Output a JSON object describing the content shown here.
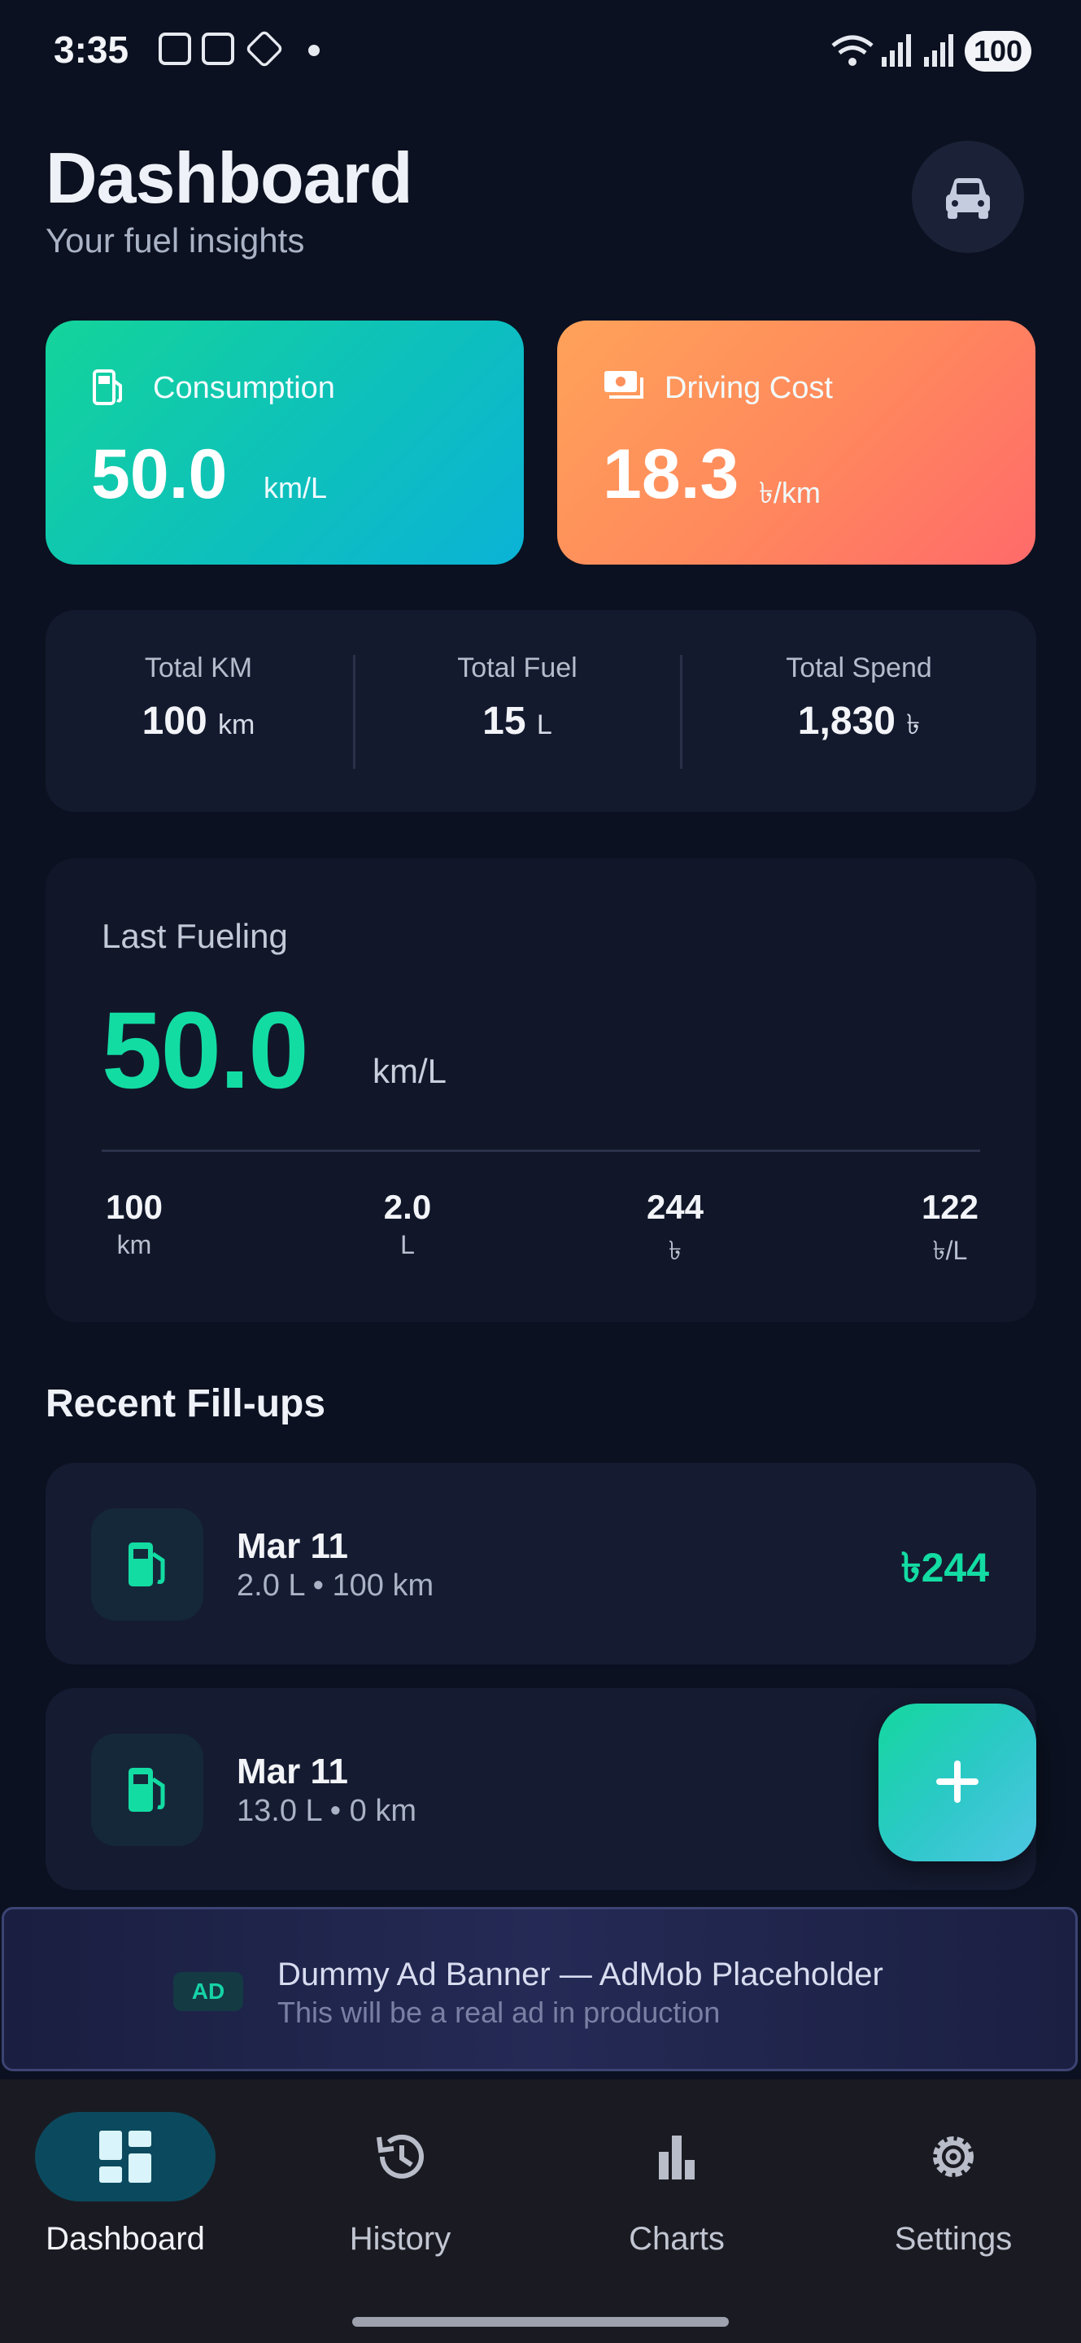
{
  "status_bar": {
    "time": "3:35",
    "battery": "100"
  },
  "header": {
    "title": "Dashboard",
    "subtitle": "Your fuel insights",
    "car_icon": "car-icon"
  },
  "cards": {
    "consumption": {
      "label": "Consumption",
      "value": "50.0",
      "unit": "km/L",
      "icon": "fuel-pump-icon",
      "colors": [
        "#14d49a",
        "#0bb3d6"
      ]
    },
    "driving_cost": {
      "label": "Driving Cost",
      "value": "18.3",
      "unit": "৳/km",
      "icon": "money-icon",
      "colors": [
        "#ffa25a",
        "#ff6a6a"
      ]
    }
  },
  "totals": [
    {
      "label": "Total KM",
      "value": "100",
      "unit": "km"
    },
    {
      "label": "Total Fuel",
      "value": "15",
      "unit": "L"
    },
    {
      "label": "Total Spend",
      "value": "1,830",
      "unit": "৳"
    }
  ],
  "last_fueling": {
    "heading": "Last Fueling",
    "value": "50.0",
    "unit": "km/L",
    "stats": [
      {
        "value": "100",
        "unit": "km"
      },
      {
        "value": "2.0",
        "unit": "L"
      },
      {
        "value": "244",
        "unit": "৳"
      },
      {
        "value": "122",
        "unit": "৳/L"
      }
    ]
  },
  "recent": {
    "title": "Recent Fill-ups",
    "items": [
      {
        "date": "Mar 11",
        "details": "2.0 L • 100 km",
        "price": "৳244"
      },
      {
        "date": "Mar 11",
        "details": "13.0 L • 0 km",
        "price": "৳"
      }
    ]
  },
  "ad": {
    "badge": "AD",
    "title": "Dummy Ad Banner — AdMob Placeholder",
    "subtitle": "This will be a real ad in production"
  },
  "nav": [
    {
      "label": "Dashboard",
      "icon": "dashboard-icon",
      "active": true
    },
    {
      "label": "History",
      "icon": "history-icon",
      "active": false
    },
    {
      "label": "Charts",
      "icon": "bar-chart-icon",
      "active": false
    },
    {
      "label": "Settings",
      "icon": "gear-icon",
      "active": false
    }
  ],
  "accent_color": "#13dca3"
}
